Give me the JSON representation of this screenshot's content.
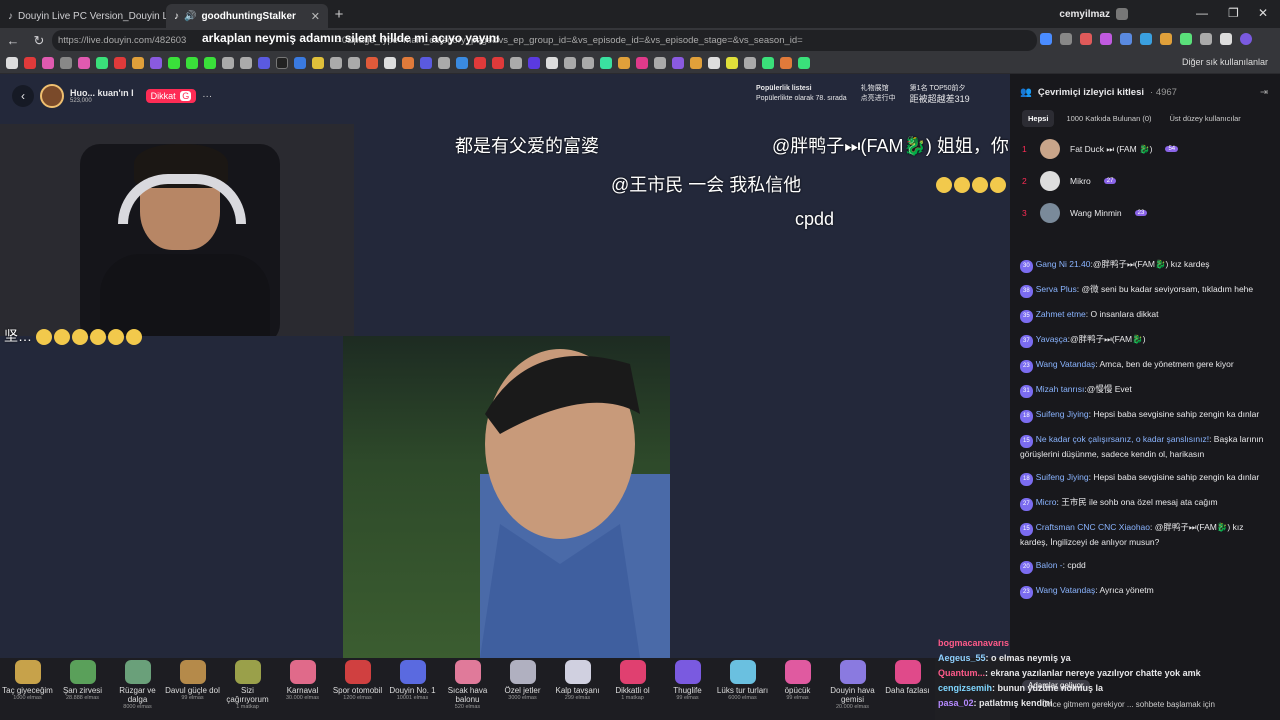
{
  "browser": {
    "tabs": [
      {
        "label": "Douyin Live PC Version_Douyin Liv",
        "active": false
      },
      {
        "label": "goodhuntingStalker",
        "active": true
      }
    ],
    "user_label": "cemyilmaz",
    "url": "https://live.douyin.com/482603",
    "url_tail": "=0&page_type=main_category_page&vs_ep_group_id=&vs_episode_id=&vs_episode_stage=&vs_season_id=",
    "url_overlay": "arkaplan neymiş adamın silent hillde mi açıyo yayını",
    "bookmarks_end": "Diğer sık kullanılanlar",
    "colors": {
      "accent": "#fe2c55",
      "bg": "#1f1f23"
    }
  },
  "host": {
    "name": "Huo... kuan'ın I",
    "sub": "523,000",
    "follow_label": "Dikkat",
    "follow_count": "G",
    "more": "···"
  },
  "rank_overlay": {
    "line1": "Popülerlik listesi",
    "line2": "Popülerlikte olarak 78. sırada",
    "line3": "礼物展馆",
    "line4": "点亮进行中",
    "line5": "第1名 TOP50前夕",
    "line6": "距被超越差319"
  },
  "danmu": [
    {
      "text": "都是有父爱的富婆"
    },
    {
      "text": "@胖鸭子⏭(FAM🐉) 姐姐，你"
    },
    {
      "text": "@王市民 一会 我私信他"
    },
    {
      "text": "cpdd"
    },
    {
      "text": "坚…"
    }
  ],
  "gifts": [
    {
      "name": "Taç giyeceğim",
      "price": "1000 elmas",
      "color": "#c7a24a"
    },
    {
      "name": "Şan zirvesi",
      "price": "28.888 elmas",
      "color": "#5aa05a"
    },
    {
      "name": "Rüzgar ve dalga",
      "price": "8000 elmas",
      "color": "#6aa07a"
    },
    {
      "name": "Davul güçle dol",
      "price": "99 elmas",
      "color": "#b58a4a"
    },
    {
      "name": "Sizi çağırıyorum",
      "price": "1 matkap",
      "color": "#9aa04a"
    },
    {
      "name": "Karnaval",
      "price": "30.000 elmas",
      "color": "#e06a8a"
    },
    {
      "name": "Spor otomobil",
      "price": "1200 elmas",
      "color": "#d04040"
    },
    {
      "name": "Douyin No. 1",
      "price": "10001 elmas",
      "color": "#5a6ae0"
    },
    {
      "name": "Sıcak hava balonu",
      "price": "520 elmas",
      "color": "#e07a9a"
    },
    {
      "name": "Özel jetler",
      "price": "3000 elmas",
      "color": "#b0b0c0"
    },
    {
      "name": "Kalp tavşanı",
      "price": "299 elmas",
      "color": "#d0d0e0"
    },
    {
      "name": "Dikkatli ol",
      "price": "1 matkap",
      "color": "#e04070"
    },
    {
      "name": "Thuglife",
      "price": "99 elmas",
      "color": "#7a5ae0"
    },
    {
      "name": "Lüks tur turları",
      "price": "6000 elmas",
      "color": "#6ac0e0"
    },
    {
      "name": "öpücük",
      "price": "99 elmas",
      "color": "#e05aa0"
    },
    {
      "name": "Douyin hava gemisi",
      "price": "20.000 elmas",
      "color": "#8a7ae0"
    },
    {
      "name": "Daha fazlası",
      "price": "",
      "color": "#e04a8a"
    }
  ],
  "panel": {
    "title": "Çevrimiçi izleyici kitlesi",
    "count": "4967",
    "tabs": [
      "Hepsi",
      "1000 Katkıda Bulunan (0)",
      "Üst düzey kullanıcılar"
    ],
    "rank": [
      {
        "n": "1",
        "name": "Fat Duck ⏭ (FAM 🐉)",
        "lv": "54"
      },
      {
        "n": "2",
        "name": "Mikro",
        "lv": "27"
      },
      {
        "n": "3",
        "name": "Wang Minmin",
        "lv": "23"
      }
    ]
  },
  "chat": [
    {
      "lv": "30",
      "user": "Gang Ni 21.40",
      "text": ":@胖鸭子⏭(FAM🐉) kız kardeş"
    },
    {
      "lv": "38",
      "user": "Serva Plus",
      "text": ": @微 seni bu kadar seviyorsam, tıkladım hehe"
    },
    {
      "lv": "35",
      "user": "Zahmet etme",
      "text": ": O insanlara dikkat"
    },
    {
      "lv": "37",
      "user": "Yavaşça",
      "text": ":@胖鸭子⏭(FAM🐉)"
    },
    {
      "lv": "23",
      "user": "Wang Vatandaş",
      "text": ": Amca, ben de yönetmem gere kiyor"
    },
    {
      "lv": "31",
      "user": "Mizah tanrısı",
      "text": ":@慢慢 Evet"
    },
    {
      "lv": "18",
      "user": "Suifeng Jiying",
      "text": ": Hepsi baba sevgisine sahip zengin ka dınlar"
    },
    {
      "lv": "15",
      "user": "Ne kadar çok çalışırsanız, o kadar şanslısınız!",
      "text": ": Başka larının görüşlerini düşünme, sadece kendin ol, harikasın"
    },
    {
      "lv": "18",
      "user": "Suifeng Jiying",
      "text": ": Hepsi baba sevgisine sahip zengin ka dınlar"
    },
    {
      "lv": "27",
      "user": "Micro",
      "text": ": 王市民 ile sohb ona özel mesaj ata cağım"
    },
    {
      "lv": "15",
      "user": "Craftsman CNC CNC Xiaohao",
      "text": ": @胖鸭子⏭(FAM🐉) kız kardeş, İngilizceyi de anlıyor musun?"
    },
    {
      "lv": "20",
      "user": "Balon -",
      "text": ": cpdd"
    },
    {
      "lv": "23",
      "user": "Wang Vatandaş",
      "text": ": Ayrıca yönetm"
    }
  ],
  "overlay_chat": [
    {
      "user": "bogmacanavarıs",
      "text": ""
    },
    {
      "user": "Aegeus_55",
      "text": ": o elmas neymiş ya"
    },
    {
      "user": "Quantum...",
      "text": ": ekrana yazılanlar nereye yazılıyor chatte yok amk"
    },
    {
      "user": "cengizsemih",
      "text": ": bunun yüzüne nolmuş la"
    },
    {
      "user": "pasa_02",
      "text": ": patlatmış kendini"
    }
  ],
  "footer": {
    "pill": "Adamlar geliyor",
    "hint": "Önce gitmem gerekiyor ... sohbete başlamak için"
  }
}
